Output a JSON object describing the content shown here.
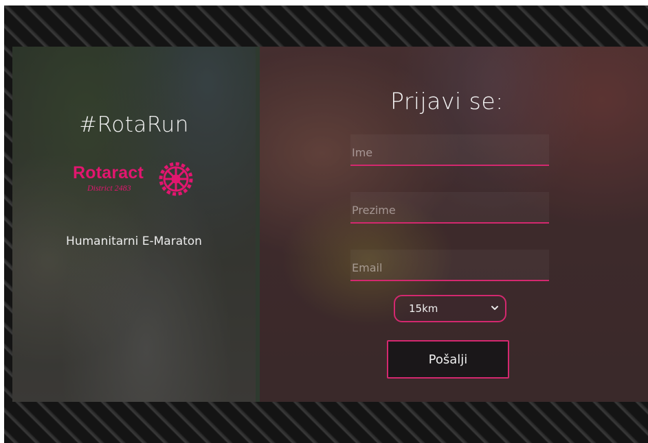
{
  "left": {
    "hashtag": "#RotaRun",
    "logo": {
      "word": "Rotaract",
      "district": "District 2483",
      "icon": "rotary-wheel-icon",
      "color": "#e2166f"
    },
    "subtitle": "Humanitarni E-Maraton"
  },
  "form": {
    "title": "Prijavi se:",
    "fields": {
      "first_name": {
        "placeholder": "Ime",
        "value": ""
      },
      "last_name": {
        "placeholder": "Prezime",
        "value": ""
      },
      "email": {
        "placeholder": "Email",
        "value": ""
      }
    },
    "distance": {
      "selected": "15km",
      "icon": "chevron-down-icon"
    },
    "submit_label": "Pošalji",
    "accent_color": "#d4286f"
  }
}
